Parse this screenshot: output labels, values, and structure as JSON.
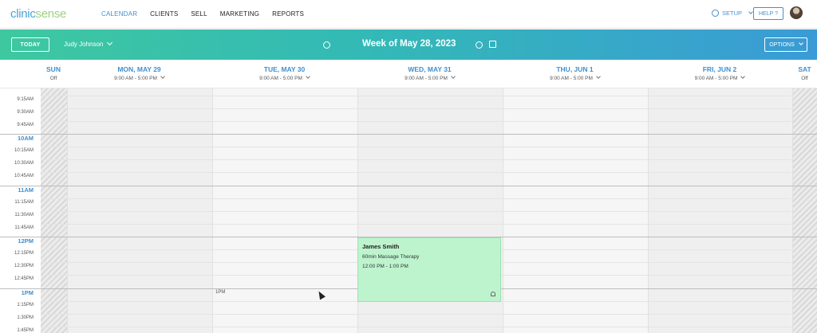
{
  "nav": {
    "logo_part1": "clinic",
    "logo_part2": "sense",
    "links": [
      "CALENDAR",
      "CLIENTS",
      "SELL",
      "MARKETING",
      "REPORTS"
    ],
    "setup_label": "SETUP",
    "help_label": "HELP ?"
  },
  "toolbar": {
    "today_label": "TODAY",
    "provider": "Judy Johnson",
    "week_title": "Week of May 28, 2023",
    "options_label": "OPTIONS"
  },
  "days": [
    {
      "name": "SUN",
      "hours": "Off"
    },
    {
      "name": "MON, MAY 29",
      "hours": "9:00 AM - 5:00 PM"
    },
    {
      "name": "TUE, MAY 30",
      "hours": "9:00 AM - 5:00 PM"
    },
    {
      "name": "WED, MAY 31",
      "hours": "9:00 AM - 5:00 PM"
    },
    {
      "name": "THU, JUN 1",
      "hours": "9:00 AM - 5:00 PM"
    },
    {
      "name": "FRI, JUN 2",
      "hours": "9:00 AM - 5:00 PM"
    },
    {
      "name": "SAT",
      "hours": "Off"
    }
  ],
  "times": [
    "9:15AM",
    "9:30AM",
    "9:45AM",
    "10AM",
    "10:15AM",
    "10:30AM",
    "10:45AM",
    "11AM",
    "11:15AM",
    "11:30AM",
    "11:45AM",
    "12PM",
    "12:15PM",
    "12:30PM",
    "12:45PM",
    "1PM",
    "1:15PM",
    "1:30PM",
    "1:45PM"
  ],
  "appointment": {
    "client": "James Smith",
    "service": "60min Massage Therapy",
    "time": "12:00 PM - 1:00 PM"
  },
  "hover_label": "1PM",
  "colors": {
    "accent": "#3f8fd0",
    "toolbar_start": "#3ec8a0",
    "toolbar_end": "#3a9bd6",
    "appointment_bg": "#bdf4cd"
  }
}
